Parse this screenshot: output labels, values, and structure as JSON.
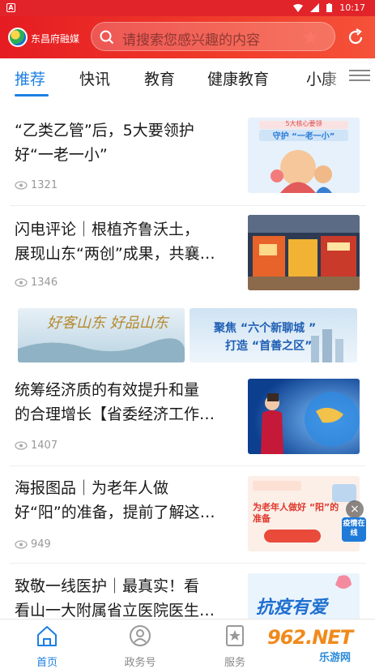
{
  "status_bar": {
    "left_badge": "A",
    "time": "10:17"
  },
  "header": {
    "brand": "东昌府融媒",
    "search_placeholder": "请搜索您感兴趣的内容"
  },
  "tabs": [
    {
      "label": "推荐",
      "active": true
    },
    {
      "label": "快讯"
    },
    {
      "label": "教育"
    },
    {
      "label": "健康教育"
    },
    {
      "label": "小康"
    }
  ],
  "news": [
    {
      "title_line1": "“乙类乙管”后，5大要领护",
      "title_line2": "好“一老一小”",
      "views": "1321",
      "thumb_caption_top": "5大核心要领",
      "thumb_caption": "守护 “一老一小”"
    },
    {
      "title_line1": "闪电评论｜根植齐鲁沃土，",
      "title_line2": "展现山东“两创”成果，共襄…",
      "views": "1346"
    },
    {
      "title_line1": "统筹经济质的有效提升和量",
      "title_line2": "的合理增长【省委经济工作…",
      "views": "1407"
    },
    {
      "title_line1": "海报图品｜为老年人做",
      "title_line2": "好“阳”的准备，提前了解这…",
      "views": "949",
      "thumb_caption": "为老年人做好 “阳”的准备"
    },
    {
      "title_line1": "致敬一线医护｜最真实！看",
      "title_line2": "看山一大附属省立医院医生…",
      "thumb_caption": "抗疫有爱"
    }
  ],
  "banners": [
    {
      "text": "好客山东 好品山东"
    },
    {
      "text_line1": "聚焦 “六个新聊城 ”",
      "text_line2": "打造 “首善之区”"
    }
  ],
  "float_badge": {
    "close": "×",
    "label": "疫情在线"
  },
  "bottom_nav": [
    {
      "label": "首页",
      "icon": "home-icon",
      "active": true
    },
    {
      "label": "政务号",
      "icon": "government-account-icon"
    },
    {
      "label": "服务",
      "icon": "service-icon"
    }
  ],
  "watermark": {
    "brand": "962.NET",
    "sub": "乐游网"
  },
  "colors": {
    "header_red": "#e51c22",
    "accent_blue": "#1d7fe0"
  }
}
